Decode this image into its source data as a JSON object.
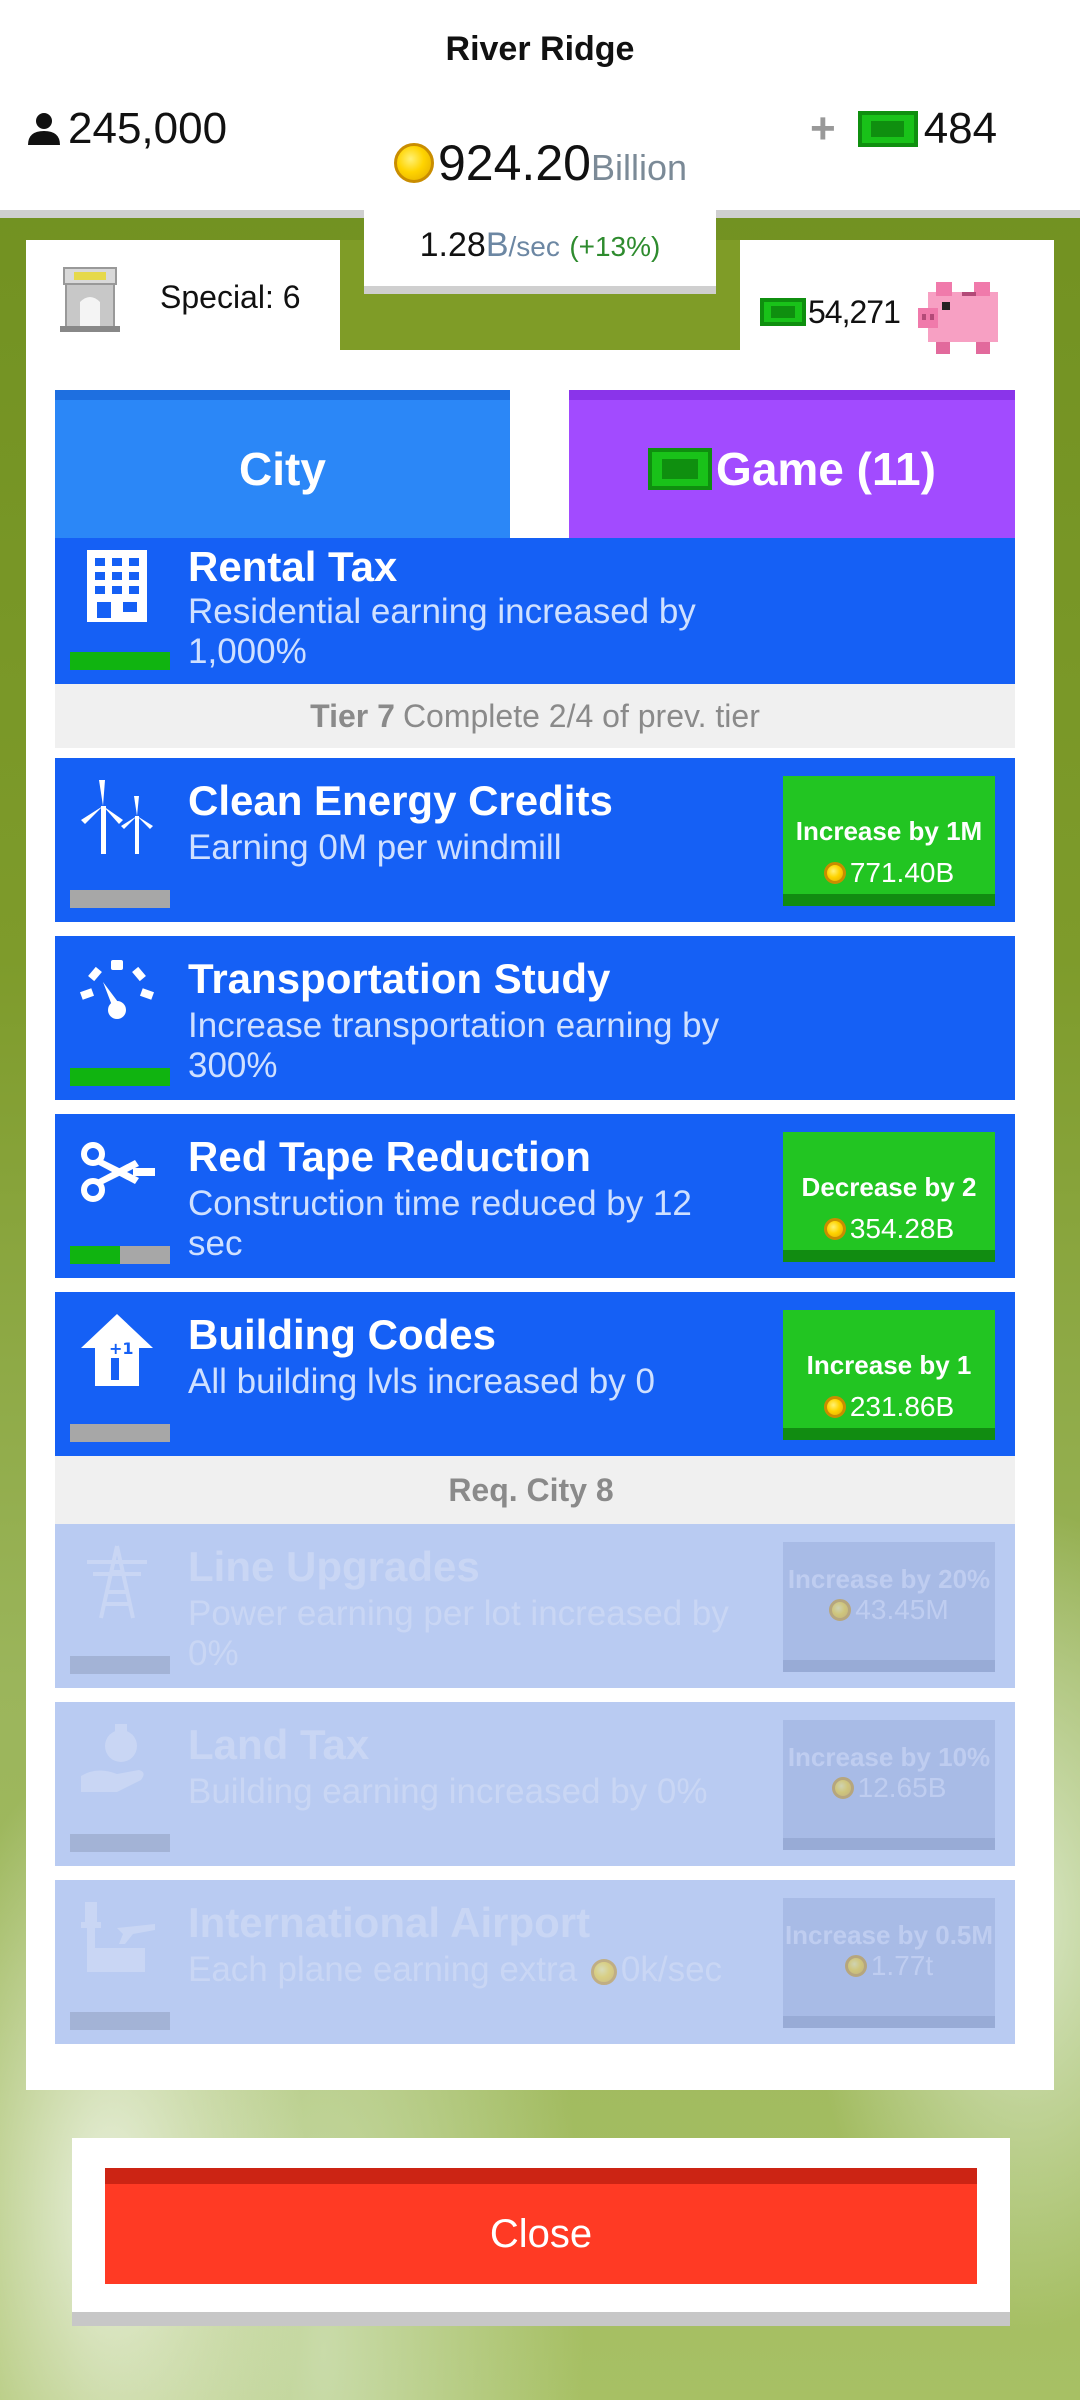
{
  "header": {
    "city_name": "River Ridge",
    "population": "245,000",
    "coins_amount": "924.20",
    "coins_unit": "Billion",
    "cash_plus": "+",
    "cash": "484",
    "rate_value": "1.28",
    "rate_b": "B",
    "rate_sec": "/sec",
    "rate_pct": "(+13%)"
  },
  "panel": {
    "special_label": "Special: 6",
    "bank_value": "54,271"
  },
  "tabs": {
    "city_label": "City",
    "game_label": "Game (11)"
  },
  "upgrades": {
    "rental_tax": {
      "title": "Rental Tax",
      "desc": "Residential earning increased by 1,000%",
      "progress": 1.0
    },
    "tier7_num": "Tier 7",
    "tier7_text": "Complete 2/4 of prev. tier",
    "clean_energy": {
      "title": "Clean Energy Credits",
      "desc": "Earning 0M per windmill",
      "button": "Increase by 1M",
      "cost": "771.40B",
      "progress": 0.0
    },
    "transportation": {
      "title": "Transportation Study",
      "desc": "Increase transportation earning by 300%",
      "progress": 1.0
    },
    "red_tape": {
      "title": "Red Tape Reduction",
      "desc": "Construction time reduced by 12 sec",
      "button": "Decrease by 2",
      "cost": "354.28B",
      "progress": 0.5
    },
    "building_codes": {
      "title": "Building Codes",
      "desc": "All building lvls increased by 0",
      "button": "Increase by 1",
      "cost": "231.86B",
      "progress": 0.0
    },
    "req_text": "Req. City 8",
    "line_upgrades": {
      "title": "Line Upgrades",
      "desc": "Power earning per lot increased by 0%",
      "button": "Increase by 20%",
      "cost": "43.45M",
      "progress": 0.0
    },
    "land_tax": {
      "title": "Land Tax",
      "desc": "Building earning increased by 0%",
      "button": "Increase by 10%",
      "cost": "12.65B",
      "progress": 0.0
    },
    "airport": {
      "title": "International Airport",
      "desc_pre": "Each plane earning extra",
      "desc_post": "0k/sec",
      "button": "Increase by 0.5M",
      "cost": "1.77t",
      "progress": 0.0
    }
  },
  "close_label": "Close",
  "colors": {
    "card_blue": "#1560f5",
    "buy_green": "#22c522",
    "tab_city": "#2b87f7",
    "tab_game": "#a24bff",
    "close_red": "#ff3a24"
  }
}
